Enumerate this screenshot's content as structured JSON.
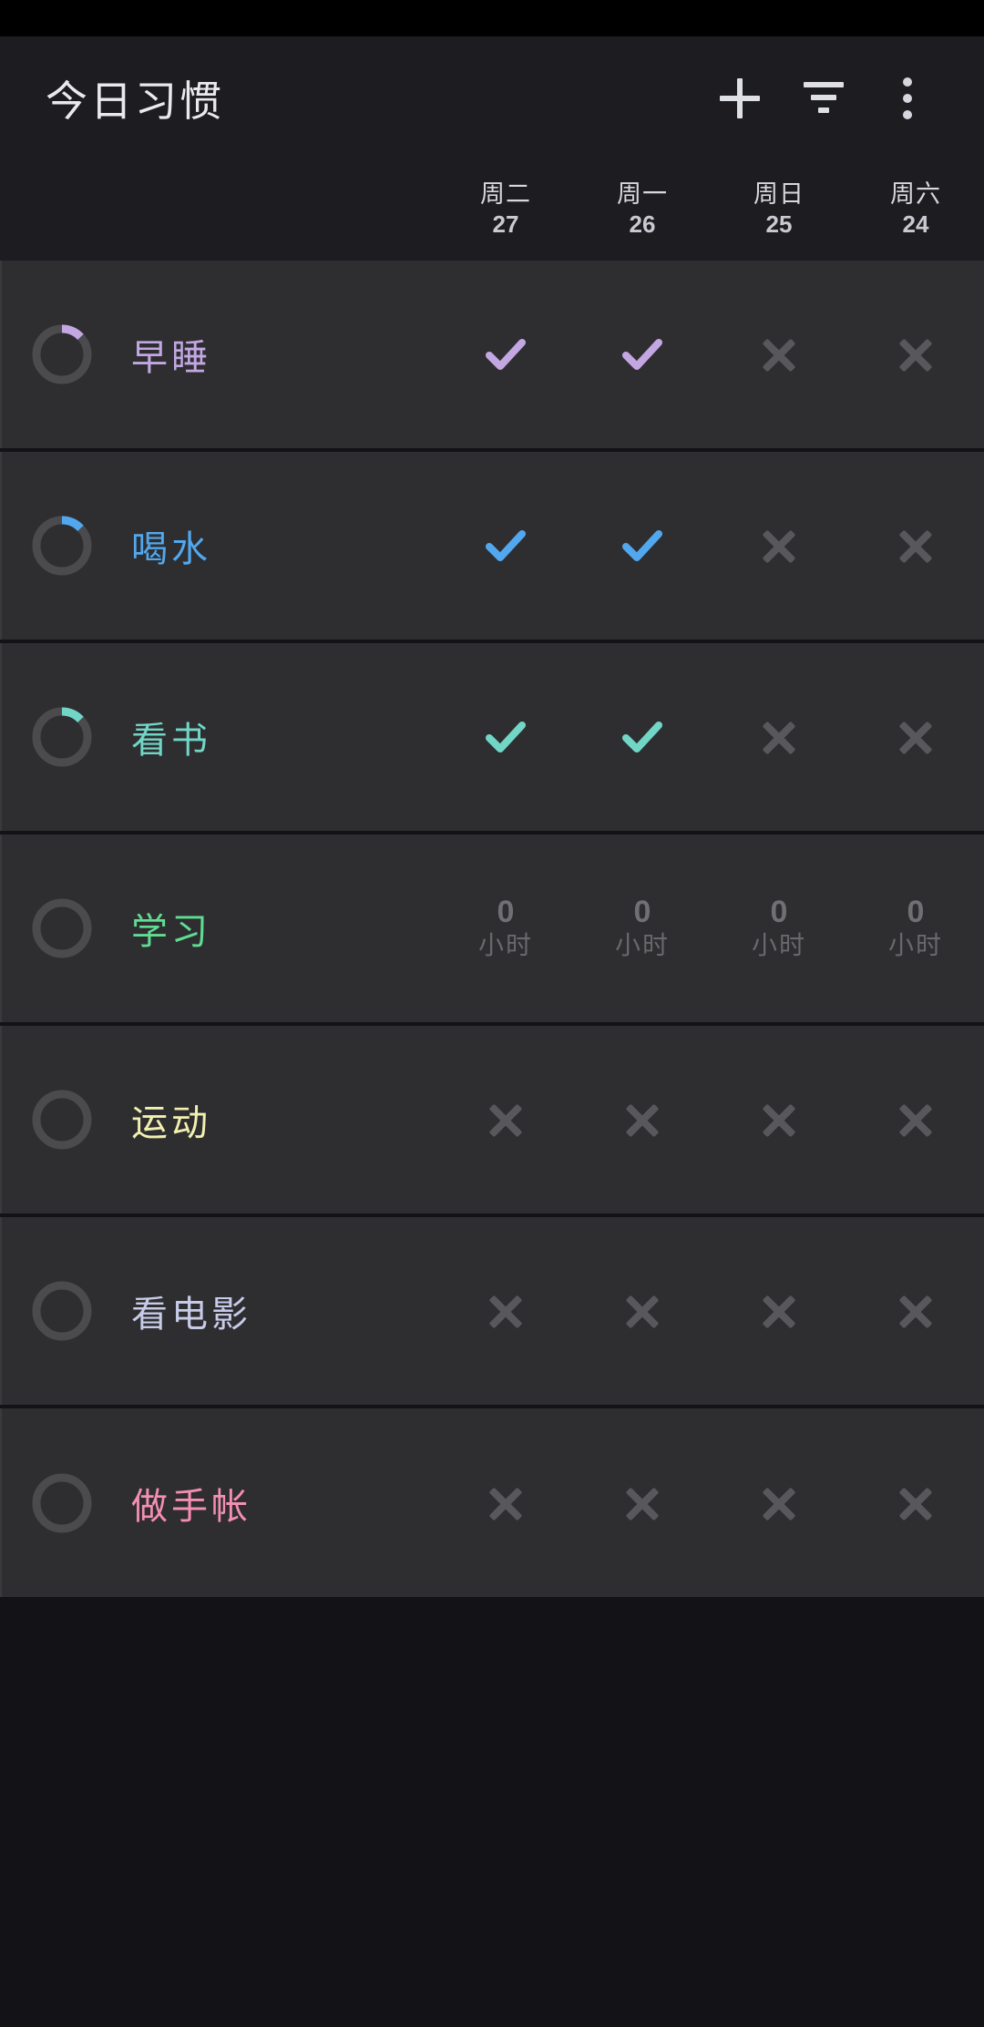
{
  "app": {
    "title": "今日习惯",
    "background": "#131317",
    "appbar_background": "#1c1c21",
    "row_background": "#2e2e30"
  },
  "toolbar": {
    "add": {
      "label": "+",
      "icon": "plus-icon"
    },
    "filter": {
      "label": "筛选",
      "icon": "filter-icon"
    },
    "overflow": {
      "label": "更多",
      "icon": "more-vertical-icon"
    }
  },
  "date_header": {
    "columns": [
      {
        "dow": "周二",
        "day": "27"
      },
      {
        "dow": "周一",
        "day": "26"
      },
      {
        "dow": "周日",
        "day": "25"
      },
      {
        "dow": "周六",
        "day": "24"
      }
    ]
  },
  "habits": [
    {
      "name": "早睡",
      "color": "#c3a7e3",
      "progress_percent": 13,
      "ring_track": "#4b4b4e",
      "cell_type": "mark",
      "cells": [
        "check",
        "check",
        "cross",
        "cross"
      ]
    },
    {
      "name": "喝水",
      "color": "#52a8ee",
      "progress_percent": 13,
      "ring_track": "#4b4b4e",
      "cell_type": "mark",
      "cells": [
        "check",
        "check",
        "cross",
        "cross"
      ]
    },
    {
      "name": "看书",
      "color": "#72d6c7",
      "progress_percent": 13,
      "ring_track": "#4b4b4e",
      "cell_type": "mark",
      "cells": [
        "check",
        "check",
        "cross",
        "cross"
      ]
    },
    {
      "name": "学习",
      "color": "#5fdd92",
      "progress_percent": 0,
      "ring_track": "#4b4b4e",
      "cell_type": "hours",
      "cells": [
        {
          "value": "0",
          "unit": "小时"
        },
        {
          "value": "0",
          "unit": "小时"
        },
        {
          "value": "0",
          "unit": "小时"
        },
        {
          "value": "0",
          "unit": "小时"
        }
      ]
    },
    {
      "name": "运动",
      "color": "#f2efb0",
      "progress_percent": 0,
      "ring_track": "#4b4b4e",
      "cell_type": "mark",
      "cells": [
        "cross",
        "cross",
        "cross",
        "cross"
      ]
    },
    {
      "name": "看电影",
      "color": "#c8cbe8",
      "progress_percent": 0,
      "ring_track": "#4b4b4e",
      "cell_type": "mark",
      "cells": [
        "cross",
        "cross",
        "cross",
        "cross"
      ]
    },
    {
      "name": "做手帐",
      "color": "#f48fb1",
      "progress_percent": 0,
      "ring_track": "#4b4b4e",
      "cell_type": "mark",
      "cells": [
        "cross",
        "cross",
        "cross",
        "cross"
      ]
    }
  ]
}
